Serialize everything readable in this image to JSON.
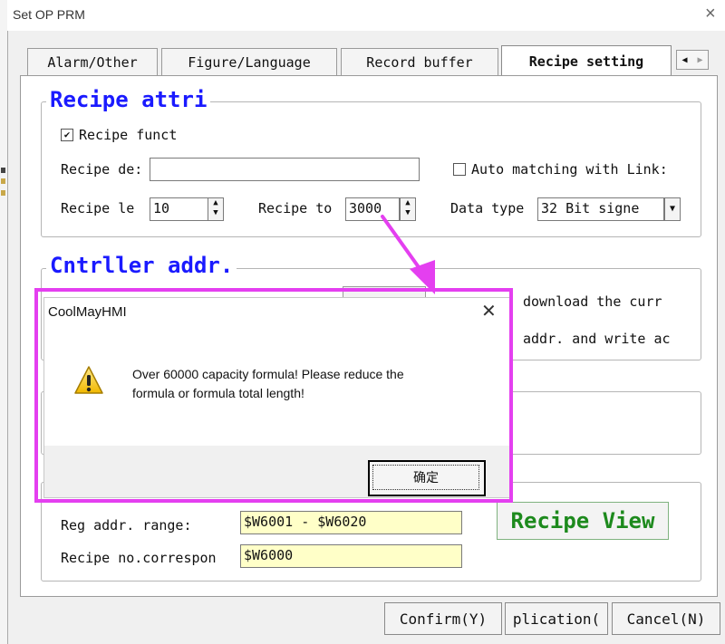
{
  "window": {
    "title": "Set OP PRM",
    "close_glyph": "×"
  },
  "tabs": [
    {
      "label": "Alarm/Other",
      "active": false
    },
    {
      "label": "Figure/Language",
      "active": false
    },
    {
      "label": "Record buffer",
      "active": false
    },
    {
      "label": "Recipe setting",
      "active": true
    }
  ],
  "tab_scroll": {
    "left": "◀",
    "right": "▶"
  },
  "recipe_attr": {
    "title": "Recipe attri",
    "recipe_function_label": "Recipe funct",
    "recipe_function_checked": true,
    "recipe_desc_label": "Recipe de:",
    "recipe_desc_value": "",
    "auto_match_label": "Auto matching with Link:",
    "auto_match_checked": false,
    "recipe_len_label": "Recipe le",
    "recipe_len_value": "10",
    "recipe_total_label": "Recipe to",
    "recipe_total_value": "3000",
    "data_type_label": "Data type",
    "data_type_value": "32 Bit signe"
  },
  "controller_addr": {
    "title": "Cntrller addr.",
    "download_text": "download the curr",
    "addr_write_text": "addr. and write ac"
  },
  "bottom_group": {
    "reg_range_label": "Reg addr. range:",
    "reg_range_value": "$W6001 - $W6020",
    "recipe_no_label": "Recipe no.correspon",
    "recipe_no_value": "$W6000",
    "recipe_view_label": "Recipe View"
  },
  "footer_buttons": {
    "confirm": "Confirm(Y)",
    "apply": "plication(",
    "cancel": "Cancel(N)"
  },
  "message_box": {
    "title": "CoolMayHMI",
    "close_glyph": "✕",
    "message_line1": "Over 60000 capacity formula! Please reduce the",
    "message_line2": "formula or formula total length!",
    "ok_label": "确定",
    "icon": "warning-icon"
  },
  "colors": {
    "group_title": "#1a1aff",
    "recipe_view": "#1d8a1d",
    "highlight": "#e43ff0",
    "field_yellow": "#ffffc8"
  }
}
